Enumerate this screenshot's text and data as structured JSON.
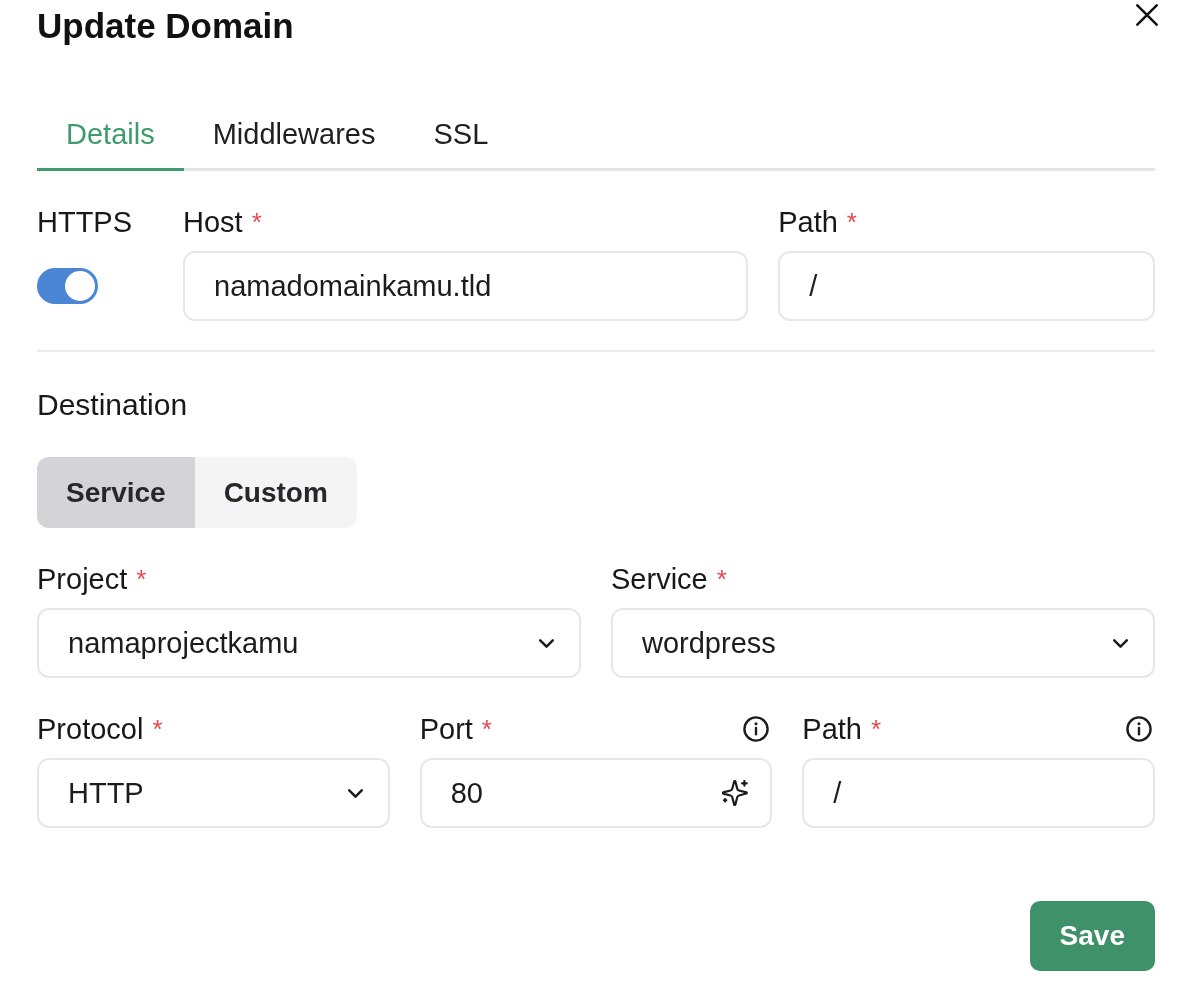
{
  "dialog": {
    "title": "Update Domain"
  },
  "tabs": [
    {
      "label": "Details",
      "selected": true
    },
    {
      "label": "Middlewares",
      "selected": false
    },
    {
      "label": "SSL",
      "selected": false
    }
  ],
  "https": {
    "label": "HTTPS",
    "on": true
  },
  "top_fields": [
    {
      "kind": "input",
      "label": "Host",
      "mark": "*",
      "value": "namadomainkamu.tld"
    },
    {
      "kind": "input",
      "label": "Path",
      "mark": "*",
      "value": "/"
    }
  ],
  "destination": {
    "heading": "Destination",
    "modes": [
      {
        "label": "Service",
        "selected": true
      },
      {
        "label": "Custom",
        "selected": false
      }
    ],
    "rows": [
      [
        {
          "kind": "select",
          "label": "Project",
          "mark": "*",
          "value": "namaprojectkamu"
        },
        {
          "kind": "select",
          "label": "Service",
          "mark": "*",
          "value": "wordpress"
        }
      ],
      [
        {
          "kind": "select",
          "label": "Protocol",
          "mark": "*",
          "value": "HTTP"
        },
        {
          "kind": "input",
          "label": "Port",
          "mark": "*",
          "value": "80",
          "info": true,
          "generate": true
        },
        {
          "kind": "input",
          "label": "Path",
          "mark": "*",
          "value": "/",
          "info": true
        }
      ]
    ]
  },
  "save_button": "Save"
}
